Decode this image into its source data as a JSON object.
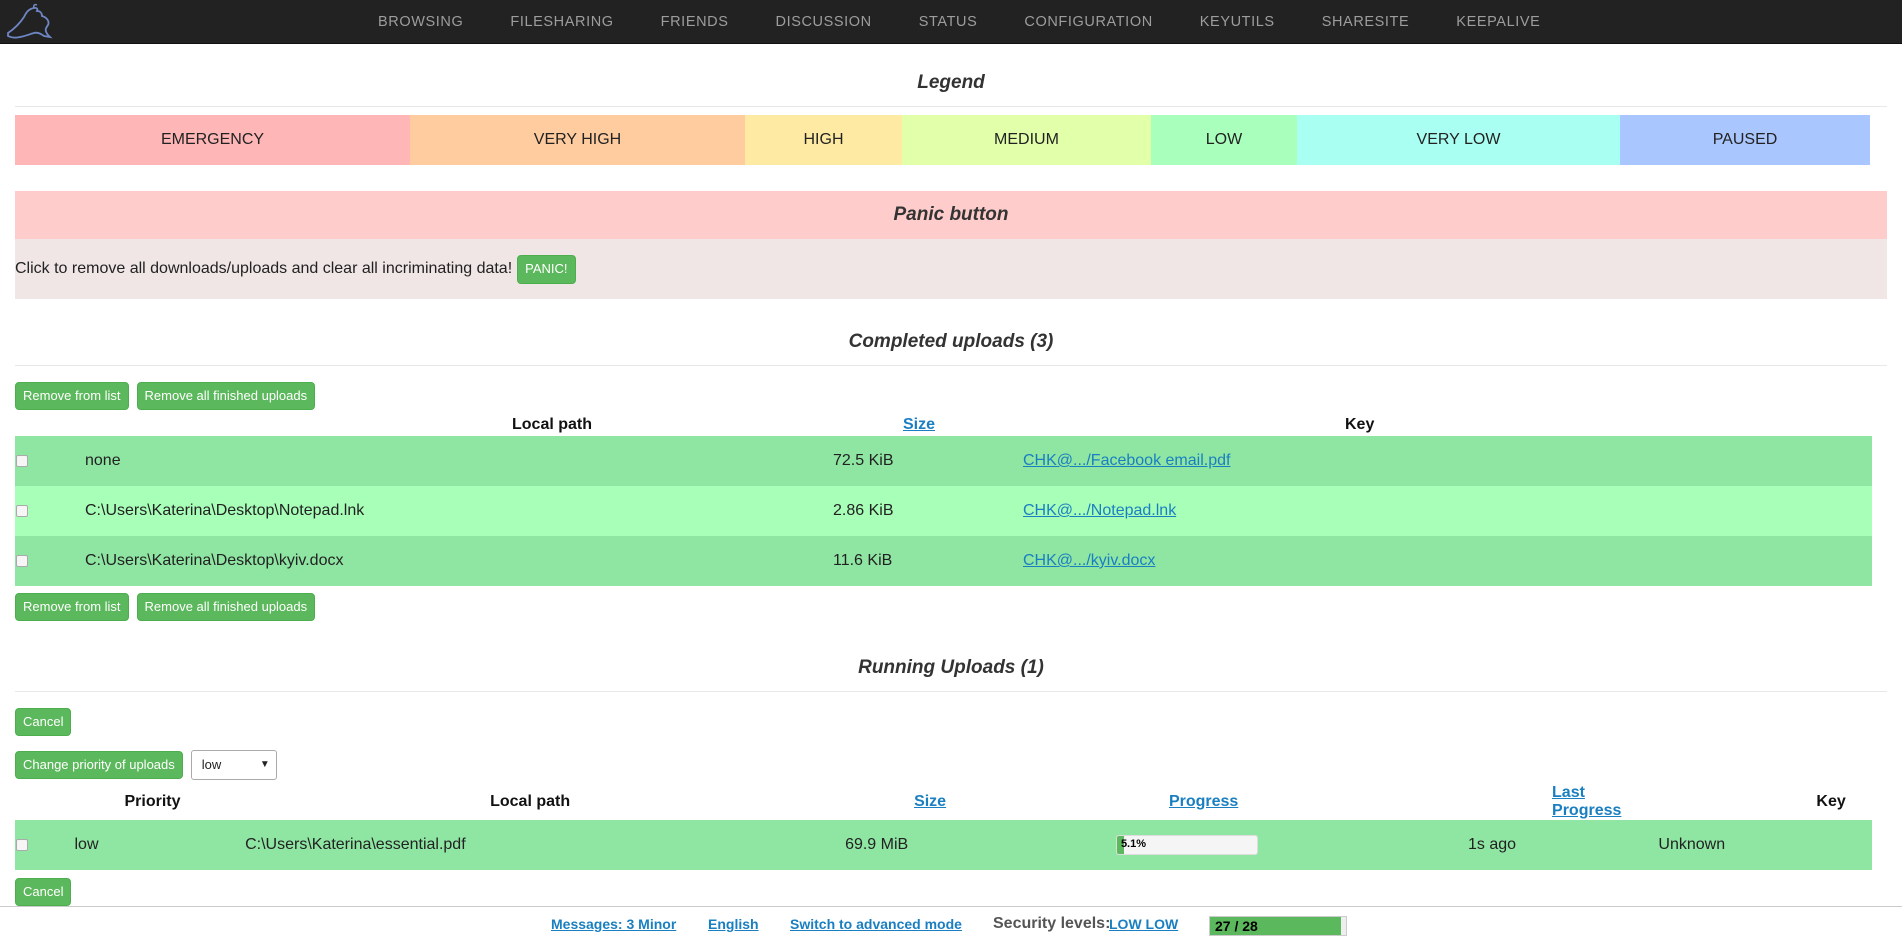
{
  "nav": {
    "items": [
      "BROWSING",
      "FILESHARING",
      "FRIENDS",
      "DISCUSSION",
      "STATUS",
      "CONFIGURATION",
      "KEYUTILS",
      "SHARESITE",
      "KEEPALIVE"
    ]
  },
  "legend": {
    "title": "Legend",
    "items": [
      {
        "label": "EMERGENCY",
        "color": "#ffb6b6"
      },
      {
        "label": "VERY HIGH",
        "color": "#ffcc9f"
      },
      {
        "label": "HIGH",
        "color": "#ffeaa3"
      },
      {
        "label": "MEDIUM",
        "color": "#e2ffa9"
      },
      {
        "label": "LOW",
        "color": "#a9ffbc"
      },
      {
        "label": "VERY LOW",
        "color": "#a9fff1"
      },
      {
        "label": "PAUSED",
        "color": "#a9c6ff"
      }
    ]
  },
  "panic": {
    "title": "Panic button",
    "text": "Click to remove all downloads/uploads and clear all incriminating data!",
    "button": "PANIC!"
  },
  "completed": {
    "title": "Completed uploads (3)",
    "remove_from_list": "Remove from list",
    "remove_all": "Remove all finished uploads",
    "headers": {
      "local_path": "Local path",
      "size": "Size",
      "key": "Key"
    },
    "rows": [
      {
        "path": "none",
        "size": "72.5 KiB",
        "key": "CHK@.../Facebook email.pdf"
      },
      {
        "path": "C:\\Users\\Katerina\\Desktop\\Notepad.lnk",
        "size": "2.86 KiB",
        "key": "CHK@.../Notepad.lnk"
      },
      {
        "path": "C:\\Users\\Katerina\\Desktop\\kyiv.docx",
        "size": "11.6 KiB",
        "key": "CHK@.../kyiv.docx"
      }
    ]
  },
  "running": {
    "title": "Running Uploads (1)",
    "cancel": "Cancel",
    "change_priority": "Change priority of uploads",
    "priority_selected": "low",
    "headers": {
      "priority": "Priority",
      "local_path": "Local path",
      "size": "Size",
      "progress": "Progress",
      "last_progress": "Last Progress",
      "key": "Key"
    },
    "rows": [
      {
        "priority": "low",
        "path": "C:\\Users\\Katerina\\essential.pdf",
        "size": "69.9 MiB",
        "progress_label": "5.1%",
        "progress_value": 0.051,
        "last_progress": "1s ago",
        "key": "Unknown"
      }
    ]
  },
  "footer": {
    "messages": "Messages: 3 Minor",
    "language": "English",
    "switch_mode": "Switch to advanced mode",
    "security_label": "Security levels:",
    "security_value": "LOW LOW",
    "peers_label": "27 / 28",
    "peers_fraction": 0.964
  }
}
